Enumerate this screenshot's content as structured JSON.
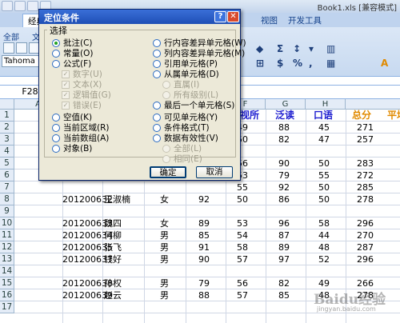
{
  "window": {
    "title": "Book1.xls [兼容模式]"
  },
  "ribbon": {
    "tabs": {
      "classic": "经典菜单",
      "start": "开",
      "view": "视图",
      "developer": "开发工具"
    },
    "menus": {
      "all": "全部",
      "file": "文件"
    },
    "font_name": "Tahoma"
  },
  "namebox": "F28",
  "columns": [
    "A",
    "B",
    "C",
    "D",
    "E",
    "F",
    "G",
    "H"
  ],
  "header_row": {
    "e_partial": "视所",
    "f": "泛读",
    "g": "口语",
    "h": "总分",
    "i_partial": "平均"
  },
  "rows": [
    {
      "n": "1"
    },
    {
      "n": "2",
      "e": "49",
      "f": "88",
      "g": "45",
      "h": "271"
    },
    {
      "n": "3",
      "e": "50",
      "f": "82",
      "g": "47",
      "h": "257"
    },
    {
      "n": "4"
    },
    {
      "n": "5",
      "e": "56",
      "f": "90",
      "g": "50",
      "h": "283"
    },
    {
      "n": "6",
      "e": "53",
      "f": "79",
      "g": "55",
      "h": "272"
    },
    {
      "n": "7",
      "e": "55",
      "f": "92",
      "g": "50",
      "h": "285"
    },
    {
      "n": "8",
      "a": "201200632",
      "b": "王淑楠",
      "c": "女",
      "d": "92",
      "e": "50",
      "f": "86",
      "g": "50",
      "h": "278"
    },
    {
      "n": "9"
    },
    {
      "n": "10",
      "a": "201200633",
      "b": "魏四",
      "c": "女",
      "d": "89",
      "e": "53",
      "f": "96",
      "g": "58",
      "h": "296"
    },
    {
      "n": "11",
      "a": "201200634",
      "b": "何柳",
      "c": "男",
      "d": "85",
      "e": "54",
      "f": "87",
      "g": "44",
      "h": "270"
    },
    {
      "n": "12",
      "a": "201200635",
      "b": "张飞",
      "c": "男",
      "d": "91",
      "e": "58",
      "f": "89",
      "g": "48",
      "h": "287"
    },
    {
      "n": "13",
      "a": "201200637",
      "b": "钱好",
      "c": "男",
      "d": "90",
      "e": "57",
      "f": "97",
      "g": "52",
      "h": "296"
    },
    {
      "n": "14"
    },
    {
      "n": "15",
      "a": "201200638",
      "b": "孙权",
      "c": "男",
      "d": "79",
      "e": "56",
      "f": "82",
      "g": "49",
      "h": "266"
    },
    {
      "n": "16",
      "a": "201200639",
      "b": "赵云",
      "c": "男",
      "d": "88",
      "e": "57",
      "f": "85",
      "g": "48",
      "h": "278"
    },
    {
      "n": "17"
    }
  ],
  "dialog": {
    "title": "定位条件",
    "help": "?",
    "close": "✕",
    "group_label": "选择",
    "left": [
      "批注(C)",
      "常量(O)",
      "公式(F)",
      "数字(U)",
      "文本(X)",
      "逻辑值(G)",
      "错误(E)",
      "空值(K)",
      "当前区域(R)",
      "当前数组(A)",
      "对象(B)"
    ],
    "right": [
      "行内容差异单元格(W)",
      "列内容差异单元格(M)",
      "引用单元格(P)",
      "从属单元格(D)",
      "直属(I)",
      "所有级别(L)",
      "最后一个单元格(S)",
      "可见单元格(Y)",
      "条件格式(T)",
      "数据有效性(V)",
      "全部(L)",
      "相同(E)"
    ],
    "ok": "确定",
    "cancel": "取消"
  },
  "watermark": {
    "main": "Baidu经验",
    "sub": "jingyan.baidu.com"
  }
}
